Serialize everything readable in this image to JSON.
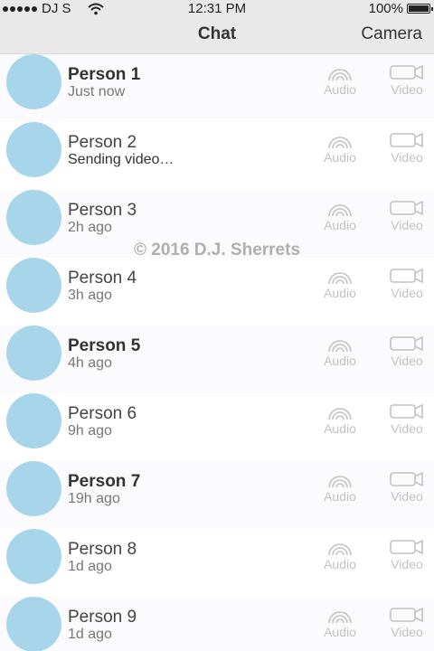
{
  "status_bar": {
    "carrier": "DJ S",
    "time": "12:31 PM",
    "battery": "100%",
    "battery_level": 1.0,
    "signal_icon": "signal-dots-icon",
    "wifi_icon": "wifi-icon"
  },
  "nav": {
    "title": "Chat",
    "right_button": "Camera"
  },
  "action_labels": {
    "audio": "Audio",
    "video": "Video"
  },
  "contacts": [
    {
      "name": "Person 1",
      "status": "Just now",
      "bold": true
    },
    {
      "name": "Person 2",
      "status": "Sending video…",
      "bold": false
    },
    {
      "name": "Person 3",
      "status": "2h ago",
      "bold": false
    },
    {
      "name": "Person 4",
      "status": "3h ago",
      "bold": false
    },
    {
      "name": "Person 5",
      "status": "4h ago",
      "bold": true
    },
    {
      "name": "Person 6",
      "status": "9h ago",
      "bold": false
    },
    {
      "name": "Person 7",
      "status": "19h ago",
      "bold": true
    },
    {
      "name": "Person 8",
      "status": "1d ago",
      "bold": false
    },
    {
      "name": "Person 9",
      "status": "1d ago",
      "bold": false
    }
  ],
  "watermark": "© 2016 D.J. Sherrets",
  "colors": {
    "avatar": "#a7d6ea",
    "bar_background": "#e9e9e9",
    "action_icon": "#c2c2c2"
  }
}
